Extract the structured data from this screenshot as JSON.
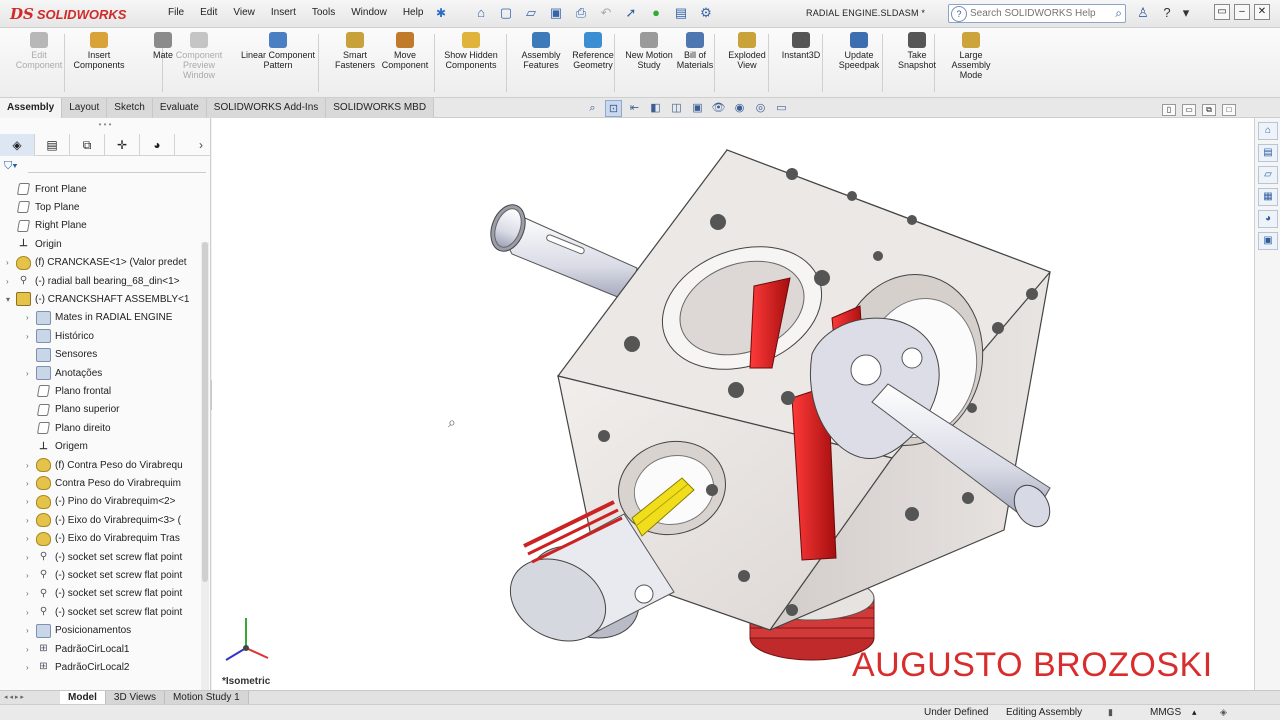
{
  "app": {
    "logo_ds": "DS",
    "logo_name": "SOLIDWORKS"
  },
  "menu": [
    "File",
    "Edit",
    "View",
    "Insert",
    "Tools",
    "Window",
    "Help"
  ],
  "document_title": "RADIAL ENGINE.SLDASM *",
  "help_search": {
    "placeholder": "Search SOLIDWORKS Help"
  },
  "command_manager": [
    {
      "label": "Edit Component",
      "disabled": true,
      "icon": "edit-component-icon"
    },
    {
      "label": "Insert Components",
      "disabled": false,
      "icon": "insert-components-icon"
    },
    {
      "label": "Mate",
      "disabled": false,
      "icon": "mate-icon"
    },
    {
      "label": "Component Preview Window",
      "disabled": true,
      "icon": "preview-window-icon"
    },
    {
      "label": "Linear Component Pattern",
      "disabled": false,
      "icon": "linear-pattern-icon"
    },
    {
      "label": "Smart Fasteners",
      "disabled": false,
      "icon": "smart-fasteners-icon"
    },
    {
      "label": "Move Component",
      "disabled": false,
      "icon": "move-component-icon"
    },
    {
      "label": "Show Hidden Components",
      "disabled": false,
      "icon": "show-hidden-icon"
    },
    {
      "label": "Assembly Features",
      "disabled": false,
      "icon": "assembly-features-icon"
    },
    {
      "label": "Reference Geometry",
      "disabled": false,
      "icon": "reference-geometry-icon"
    },
    {
      "label": "New Motion Study",
      "disabled": false,
      "icon": "motion-study-icon"
    },
    {
      "label": "Bill of Materials",
      "disabled": false,
      "icon": "bom-icon"
    },
    {
      "label": "Exploded View",
      "disabled": false,
      "icon": "exploded-view-icon"
    },
    {
      "label": "Instant3D",
      "disabled": false,
      "icon": "instant3d-icon"
    },
    {
      "label": "Update Speedpak",
      "disabled": false,
      "icon": "speedpak-icon"
    },
    {
      "label": "Take Snapshot",
      "disabled": false,
      "icon": "snapshot-icon"
    },
    {
      "label": "Large Assembly Mode",
      "disabled": false,
      "icon": "large-assembly-icon"
    }
  ],
  "tabs": [
    "Assembly",
    "Layout",
    "Sketch",
    "Evaluate",
    "SOLIDWORKS Add-Ins",
    "SOLIDWORKS MBD"
  ],
  "active_tab": "Assembly",
  "feature_tree": [
    {
      "label": "Front Plane",
      "icon": "plane-icon",
      "expand": false,
      "indent": 0
    },
    {
      "label": "Top Plane",
      "icon": "plane-icon",
      "expand": false,
      "indent": 0
    },
    {
      "label": "Right Plane",
      "icon": "plane-icon",
      "expand": false,
      "indent": 0
    },
    {
      "label": "Origin",
      "icon": "origin-icon",
      "expand": false,
      "indent": 0
    },
    {
      "label": "(f) CRANCKASE<1> (Valor predet",
      "icon": "part-icon",
      "expand": true,
      "indent": 0
    },
    {
      "label": "(-) radial ball bearing_68_din<1>",
      "icon": "screw-icon",
      "expand": true,
      "indent": 0
    },
    {
      "label": "(-) CRANCKSHAFT ASSEMBLY<1",
      "icon": "assembly-icon",
      "expand": true,
      "open": true,
      "indent": 0
    },
    {
      "label": "Mates in RADIAL ENGINE",
      "icon": "folder-icon",
      "expand": true,
      "indent": 1
    },
    {
      "label": "Histórico",
      "icon": "folder-icon",
      "expand": true,
      "indent": 1
    },
    {
      "label": "Sensores",
      "icon": "folder-icon",
      "expand": false,
      "indent": 1
    },
    {
      "label": "Anotações",
      "icon": "folder-icon",
      "expand": true,
      "indent": 1
    },
    {
      "label": "Plano frontal",
      "icon": "plane-icon",
      "expand": false,
      "indent": 1
    },
    {
      "label": "Plano superior",
      "icon": "plane-icon",
      "expand": false,
      "indent": 1
    },
    {
      "label": "Plano direito",
      "icon": "plane-icon",
      "expand": false,
      "indent": 1
    },
    {
      "label": "Origem",
      "icon": "origin-icon",
      "expand": false,
      "indent": 1
    },
    {
      "label": "(f) Contra Peso do Virabrequ",
      "icon": "part-icon",
      "expand": true,
      "indent": 1
    },
    {
      "label": "Contra Peso do Virabrequim",
      "icon": "part-icon",
      "expand": true,
      "indent": 1
    },
    {
      "label": "(-) Pino do Virabrequim<2>",
      "icon": "part-icon",
      "expand": true,
      "indent": 1
    },
    {
      "label": "(-) Eixo do Virabrequim<3> (",
      "icon": "part-icon",
      "expand": true,
      "indent": 1
    },
    {
      "label": "(-) Eixo do Virabrequim Tras",
      "icon": "part-icon",
      "expand": true,
      "indent": 1
    },
    {
      "label": "(-) socket set screw flat point",
      "icon": "screw-icon",
      "expand": true,
      "indent": 1
    },
    {
      "label": "(-) socket set screw flat point",
      "icon": "screw-icon",
      "expand": true,
      "indent": 1
    },
    {
      "label": "(-) socket set screw flat point",
      "icon": "screw-icon",
      "expand": true,
      "indent": 1
    },
    {
      "label": "(-) socket set screw flat point",
      "icon": "screw-icon",
      "expand": true,
      "indent": 1
    },
    {
      "label": "Posicionamentos",
      "icon": "mates-icon",
      "expand": true,
      "indent": 1
    },
    {
      "label": "PadrãoCirLocal1",
      "icon": "pattern-icon",
      "expand": true,
      "indent": 1
    },
    {
      "label": "PadrãoCirLocal2",
      "icon": "pattern-icon",
      "expand": true,
      "indent": 1
    }
  ],
  "viewport": {
    "view_label": "*Isometric",
    "watermark": "AUGUSTO BROZOSKI"
  },
  "bottom_tabs": [
    "Model",
    "3D Views",
    "Motion Study 1"
  ],
  "status": {
    "definition": "Under Defined",
    "mode": "Editing Assembly",
    "units": "MMGS"
  },
  "colors": {
    "accent_red": "#d92c2c",
    "part_gray": "#e8e4e2",
    "rod_red": "#d21e1e",
    "pin_yellow": "#f0de1c"
  }
}
